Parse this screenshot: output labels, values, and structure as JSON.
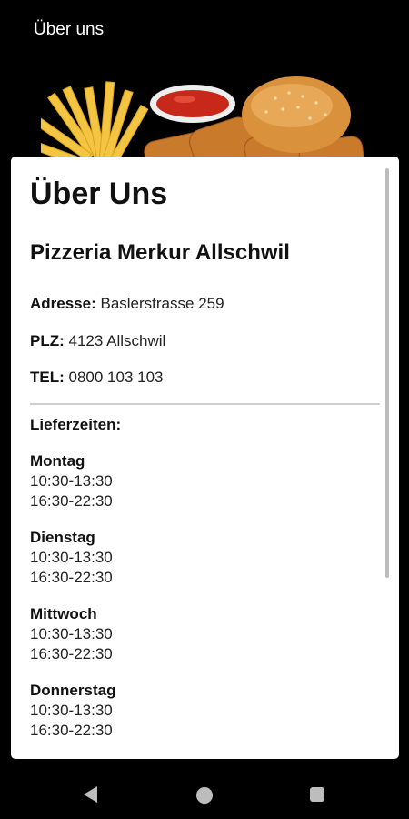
{
  "appbar": {
    "title": "Über uns"
  },
  "page": {
    "heading": "Über Uns",
    "business_name": "Pizzeria Merkur Allschwil",
    "info": [
      {
        "label": "Adresse:",
        "value": " Baslerstrasse 259"
      },
      {
        "label": "PLZ:",
        "value": " 4123 Allschwil"
      },
      {
        "label": "TEL:",
        "value": " 0800 103 103"
      }
    ],
    "delivery_label": "Lieferzeiten:",
    "days": [
      {
        "name": "Montag",
        "slot1": "10:30-13:30",
        "slot2": "16:30-22:30"
      },
      {
        "name": "Dienstag",
        "slot1": "10:30-13:30",
        "slot2": "16:30-22:30"
      },
      {
        "name": "Mittwoch",
        "slot1": "10:30-13:30",
        "slot2": "16:30-22:30"
      },
      {
        "name": "Donnerstag",
        "slot1": "10:30-13:30",
        "slot2": "16:30-22:30"
      }
    ]
  },
  "icons": {
    "back": "back-triangle-icon",
    "home": "home-circle-icon",
    "recent": "recent-apps-square-icon"
  },
  "colors": {
    "background": "#000000",
    "card": "#ffffff",
    "sauce": "#c8281a",
    "fries": "#f4c542",
    "bun": "#d9913c"
  }
}
